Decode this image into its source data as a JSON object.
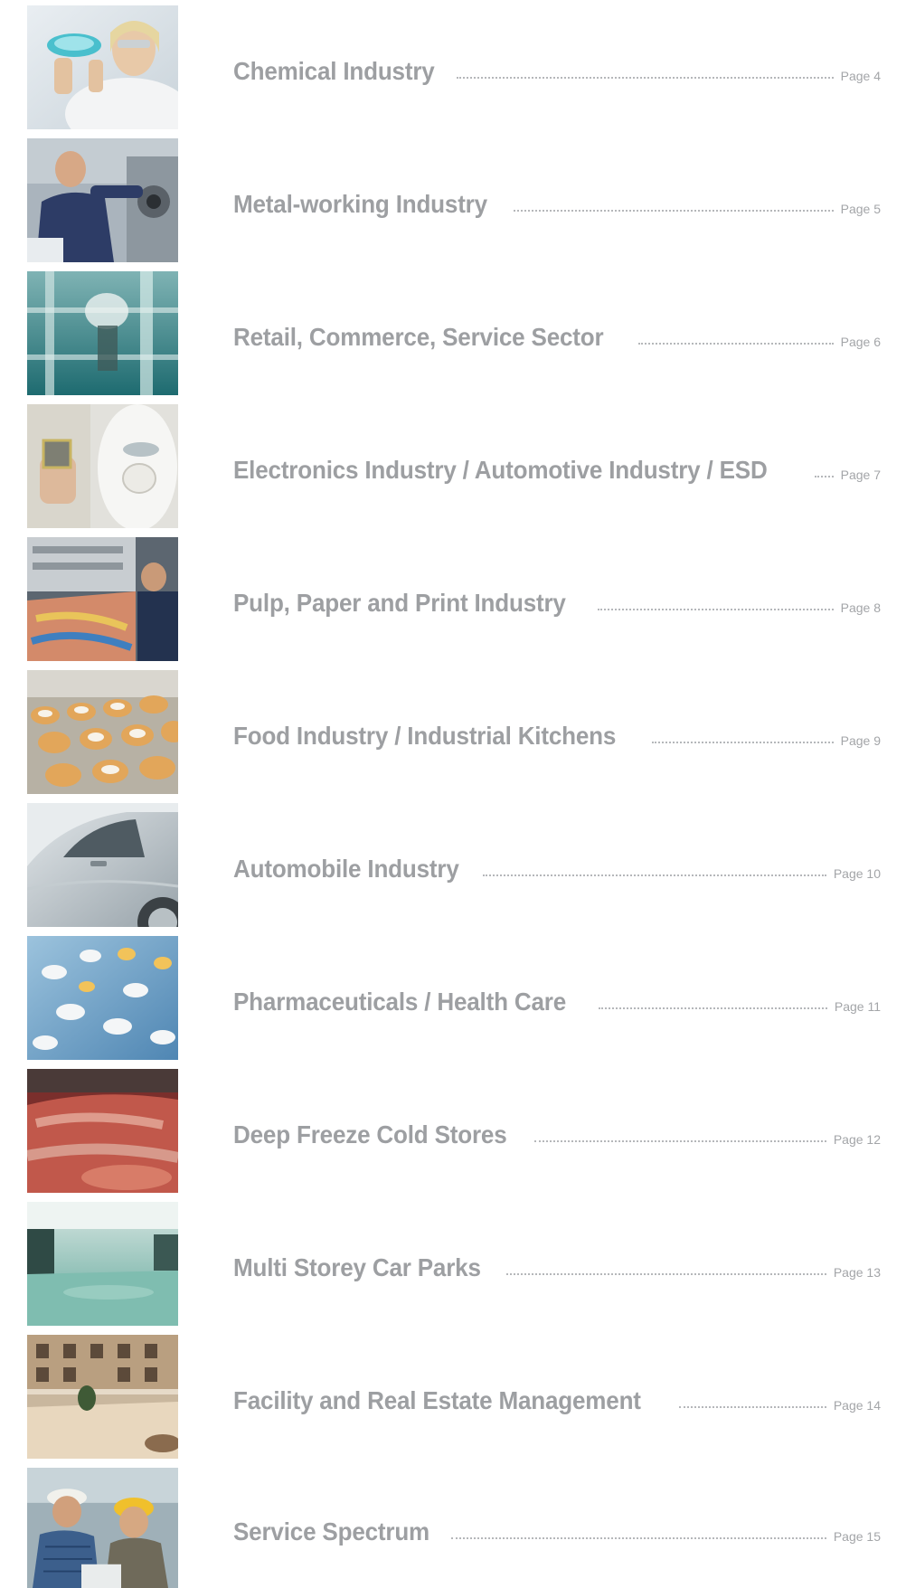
{
  "entries": [
    {
      "title": "Chemical Industry",
      "page": "Page 4",
      "photo": "chemical-lab-photo"
    },
    {
      "title": "Metal-working Industry",
      "page": "Page 5",
      "photo": "metal-worker-photo"
    },
    {
      "title": "Retail, Commerce, Service Sector",
      "page": "Page 6",
      "photo": "shopping-mall-photo"
    },
    {
      "title": "Electronics Industry / Automotive Industry / ESD",
      "page": "Page 7",
      "photo": "cleanroom-worker-photo"
    },
    {
      "title": "Pulp, Paper and Print Industry",
      "page": "Page 8",
      "photo": "printing-press-photo"
    },
    {
      "title": "Food Industry / Industrial Kitchens",
      "page": "Page 9",
      "photo": "bakery-conveyor-photo"
    },
    {
      "title": "Automobile Industry",
      "page": "Page 10",
      "photo": "silver-car-photo"
    },
    {
      "title": "Pharmaceuticals / Health Care",
      "page": "Page 11",
      "photo": "pills-photo"
    },
    {
      "title": "Deep Freeze Cold Stores",
      "page": "Page 12",
      "photo": "frozen-meat-photo"
    },
    {
      "title": "Multi Storey Car Parks",
      "page": "Page 13",
      "photo": "car-park-photo"
    },
    {
      "title": "Facility and Real Estate Management",
      "page": "Page 14",
      "photo": "building-atrium-photo"
    },
    {
      "title": "Service Spectrum",
      "page": "Page 15",
      "photo": "construction-workers-photo"
    }
  ],
  "colors": {
    "title": "#9d9fa2",
    "page_ref": "#a3a5a8",
    "leader": "#b5b7ba"
  }
}
